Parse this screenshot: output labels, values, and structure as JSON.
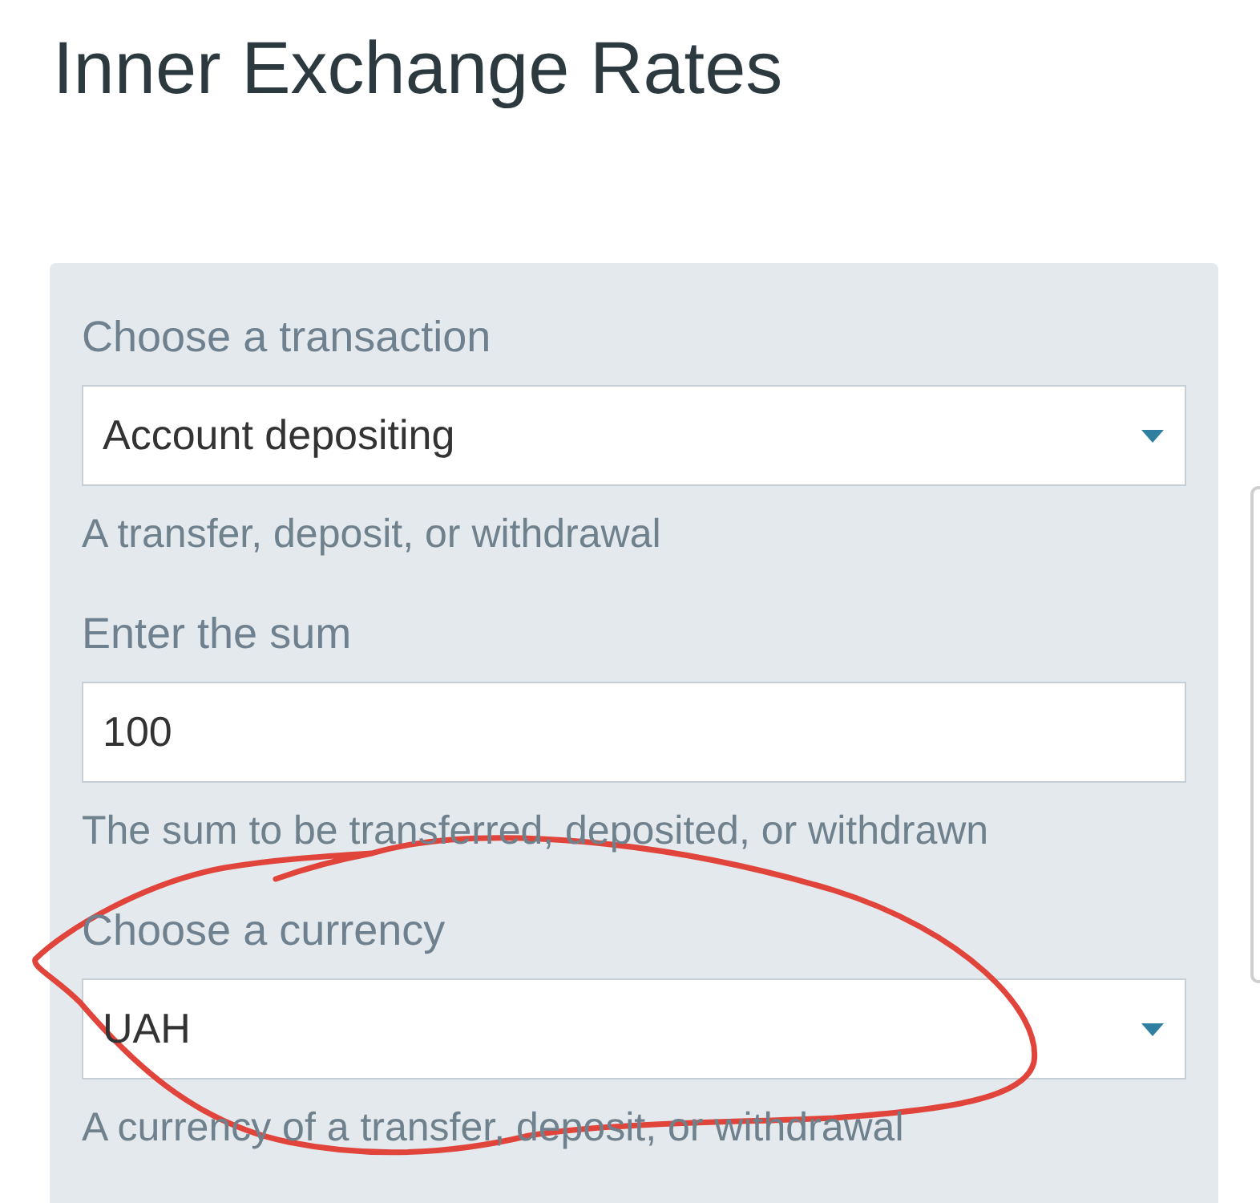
{
  "title": "Inner Exchange Rates",
  "form": {
    "fields": [
      {
        "kind": "select",
        "label": "Choose a transaction",
        "value": "Account depositing",
        "help_text": "A transfer, deposit, or withdrawal"
      },
      {
        "kind": "input",
        "label": "Enter the sum",
        "value": "100",
        "help_text": "The sum to be transferred, deposited, or withdrawn"
      },
      {
        "kind": "select",
        "label": "Choose a currency",
        "value": "UAH",
        "help_text": "A currency of a transfer, deposit, or withdrawal"
      }
    ]
  },
  "annotation": {
    "kind": "loop"
  }
}
